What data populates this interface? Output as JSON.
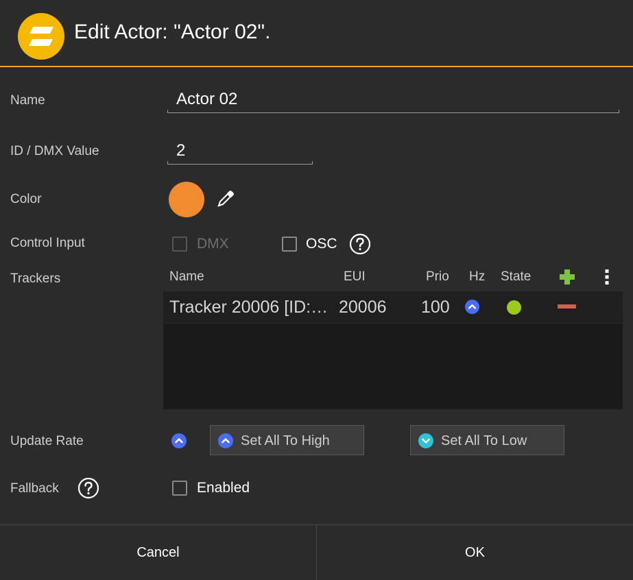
{
  "header": {
    "title": "Edit Actor: \"Actor 02\".",
    "logo_icon": "app-logo-icon"
  },
  "form": {
    "name_label": "Name",
    "name_value": "Actor 02",
    "id_label": "ID / DMX Value",
    "id_value": "2",
    "color_label": "Color",
    "color_value": "#f28a30",
    "control_input_label": "Control Input",
    "dmx_label": "DMX",
    "osc_label": "OSC",
    "trackers_label": "Trackers",
    "update_rate_label": "Update Rate",
    "fallback_label": "Fallback",
    "fallback_option_label": "Enabled"
  },
  "trackers": {
    "columns": [
      "Name",
      "EUI",
      "Prio",
      "Hz",
      "State"
    ],
    "rows": [
      {
        "name": "Tracker 20006 [ID:…",
        "eui": "20006",
        "prio": "100",
        "hz_icon": "chevron-up-circle-icon",
        "state_icon": "status-dot-icon"
      }
    ]
  },
  "update_rate": {
    "current_icon": "chevron-up-circle-icon",
    "set_high_label": "Set All To High",
    "set_low_label": "Set All To Low"
  },
  "footer": {
    "cancel_label": "Cancel",
    "ok_label": "OK"
  },
  "colors": {
    "accent": "#f5a623",
    "high_rate": "#4a6cf7",
    "low_rate": "#2ec4d6",
    "state_ok": "#9ccc1a",
    "add": "#7dc242",
    "remove": "#d2604f"
  }
}
